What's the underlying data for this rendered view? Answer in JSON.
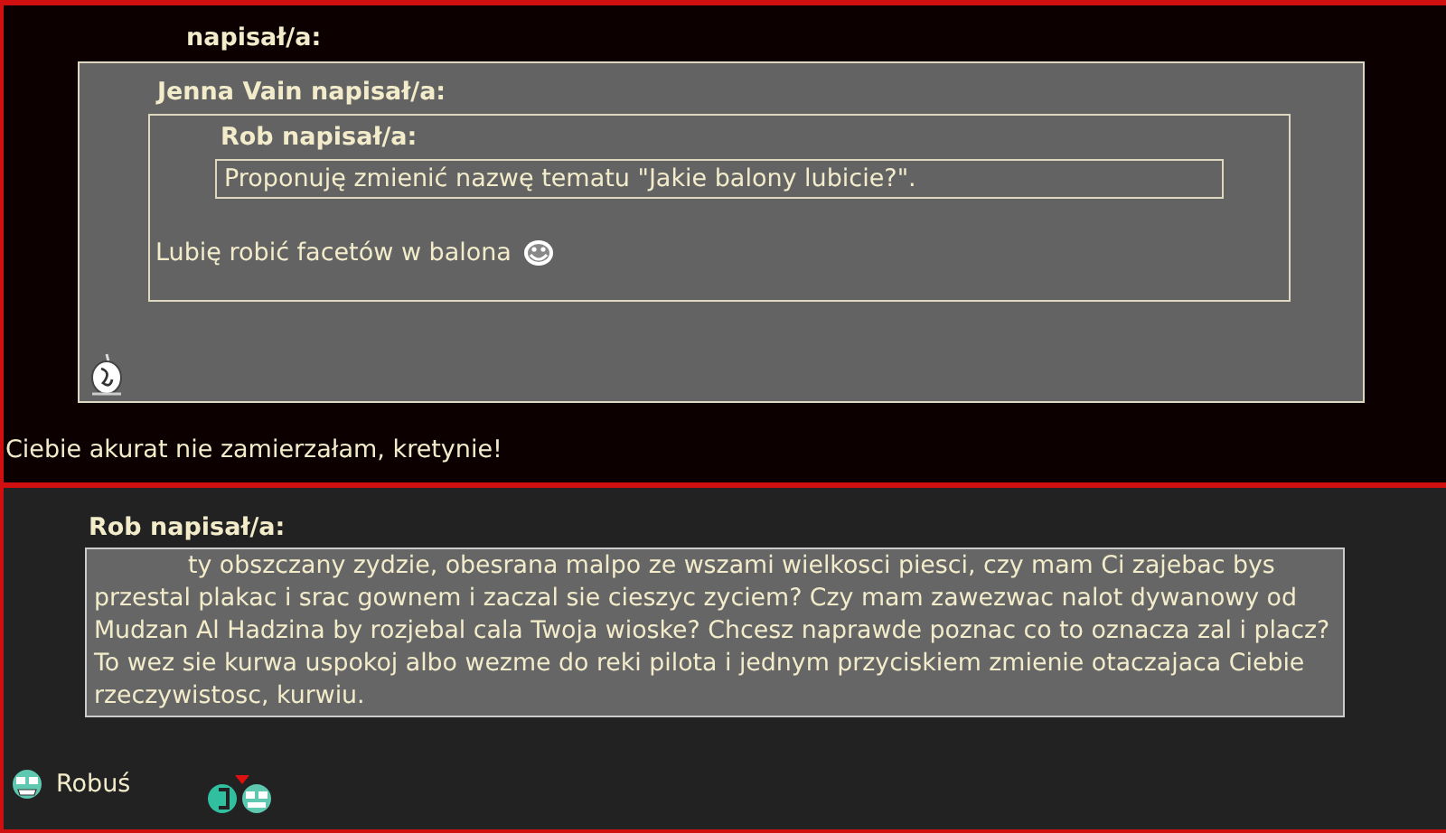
{
  "posts": [
    {
      "heading": "napisał/a:",
      "quote": {
        "author": "Jenna Vain napisał/a:",
        "quote": {
          "author": "Rob napisał/a:",
          "text": "Proponuję zmienić nazwę tematu \"Jakie balony lubicie?\"."
        },
        "text": "Lubię robić facetów w balona"
      },
      "reply": "Ciebie akurat nie zamierzałam, kretynie!"
    },
    {
      "quote": {
        "author": "Rob napisał/a:",
        "text": "ty obszczany zydzie, obesrana malpo ze wszami wielkosci piesci, czy mam Ci zajebac bys przestal plakac i srac gownem i zaczal sie cieszyc zyciem? Czy mam zawezwac nalot dywanowy od Mudzan Al Hadzina by rozjebal cala Twoja wioske? Chcesz naprawde poznac co to oznacza zal i placz? To wez sie kurwa uspokoj albo wezme do reki pilota i jednym przyciskiem zmienie otaczajaca Ciebie rzeczywistosc, kurwiu."
      },
      "signature": "Robuś"
    }
  ]
}
